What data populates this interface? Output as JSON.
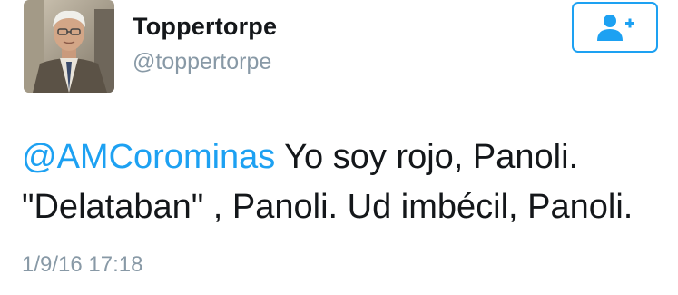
{
  "user": {
    "display_name": "Toppertorpe",
    "handle": "@toppertorpe",
    "avatar_icon": "profile-photo"
  },
  "follow_button": {
    "icon": "follow-user-icon",
    "color": "#1da1f2"
  },
  "tweet": {
    "mention": "@AMCorominas",
    "line1_text": " Yo soy rojo, Panoli.",
    "line2_text": "\"Delataban\" ,  Panoli. Ud imbécil, Panoli.",
    "timestamp": "1/9/16 17:18"
  },
  "colors": {
    "accent": "#1da1f2",
    "text": "#14171a",
    "muted": "#8899a6"
  }
}
